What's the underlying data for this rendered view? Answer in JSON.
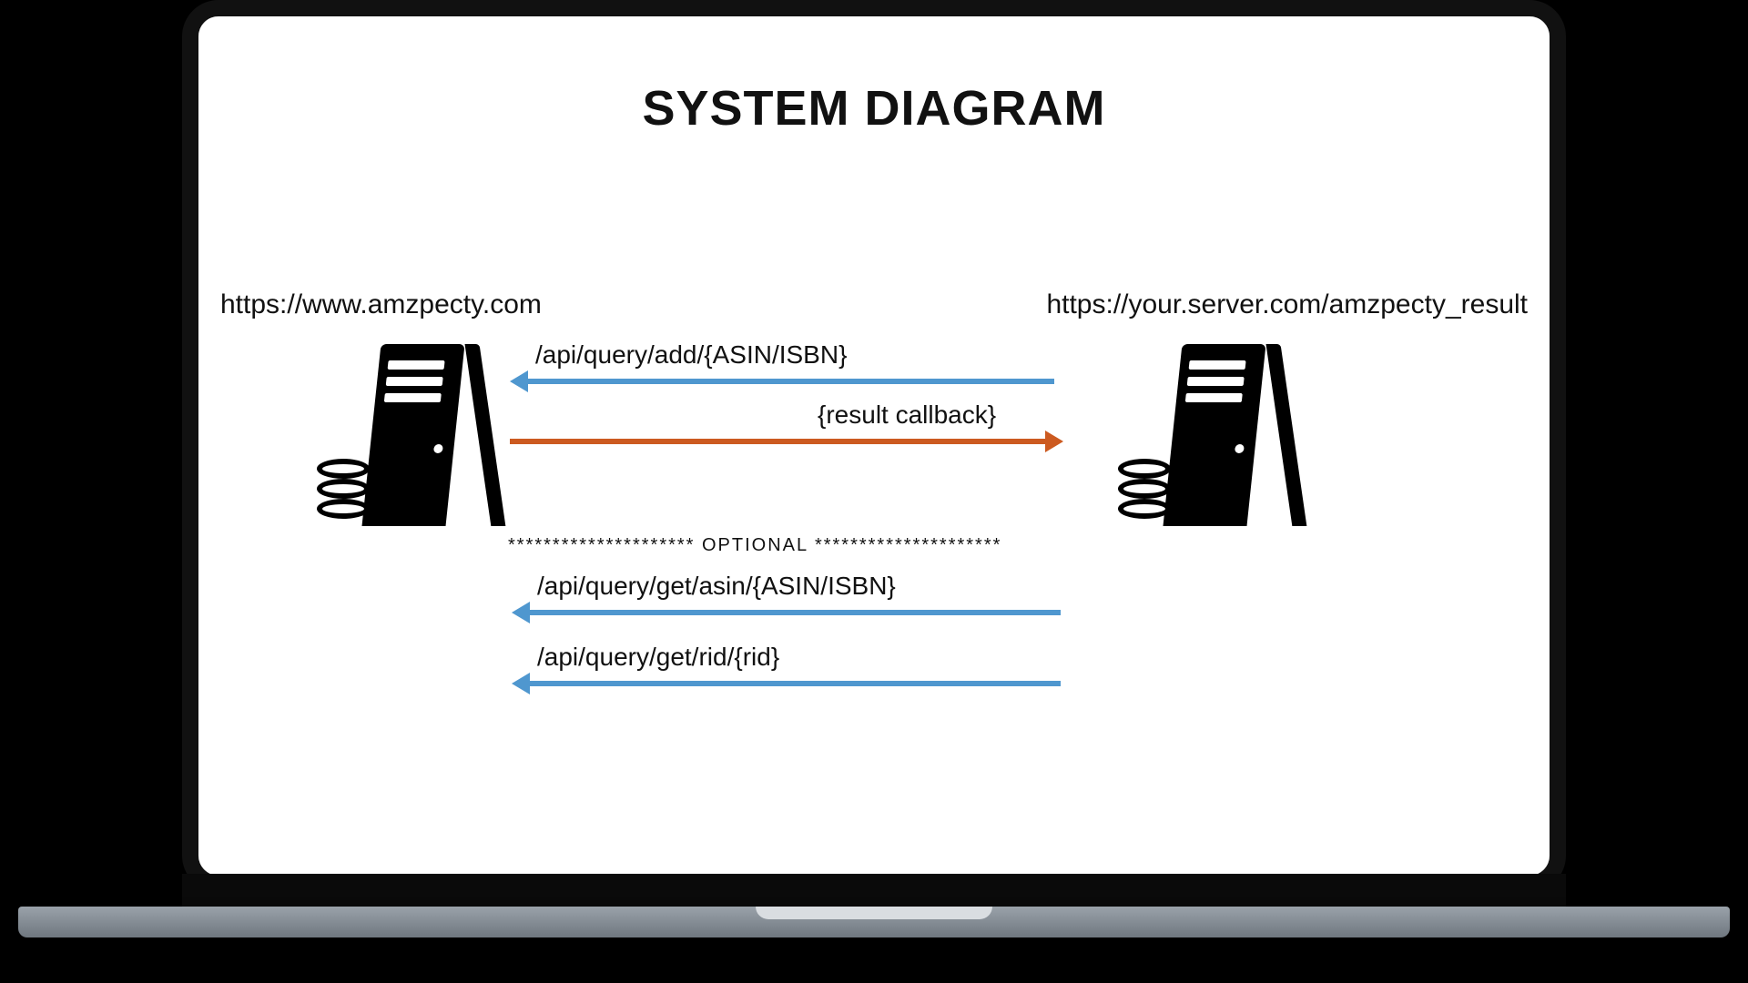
{
  "title": "SYSTEM DIAGRAM",
  "left_url": "https://www.amzpecty.com",
  "right_url": "https://your.server.com/amzpecty_result",
  "arrows": {
    "add": "/api/query/add/{ASIN/ISBN}",
    "callback": "{result callback}",
    "divider": "********************* OPTIONAL *********************",
    "get_asin": "/api/query/get/asin/{ASIN/ISBN}",
    "get_rid": "/api/query/get/rid/{rid}"
  },
  "colors": {
    "blue": "#4f97cf",
    "orange": "#cc5a20"
  }
}
